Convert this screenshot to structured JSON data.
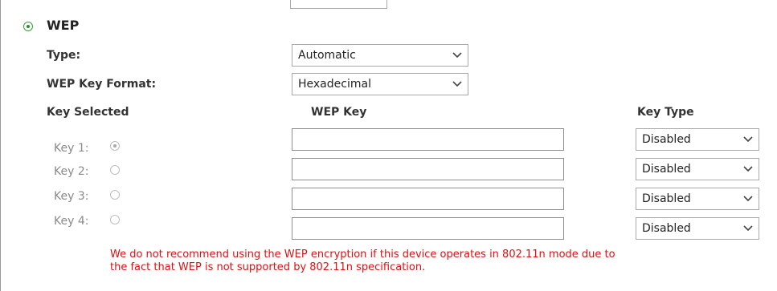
{
  "security_mode": {
    "label": "WEP",
    "selected": true
  },
  "type": {
    "label": "Type:",
    "value": "Automatic"
  },
  "key_format": {
    "label": "WEP Key Format:",
    "value": "Hexadecimal"
  },
  "columns": {
    "key_selected": "Key Selected",
    "wep_key": "WEP Key",
    "key_type": "Key Type"
  },
  "keys": [
    {
      "label": "Key 1:",
      "selected": true,
      "value": "",
      "type": "Disabled"
    },
    {
      "label": "Key 2:",
      "selected": false,
      "value": "",
      "type": "Disabled"
    },
    {
      "label": "Key 3:",
      "selected": false,
      "value": "",
      "type": "Disabled"
    },
    {
      "label": "Key 4:",
      "selected": false,
      "value": "",
      "type": "Disabled"
    }
  ],
  "warning": {
    "line1": "We do not recommend using the WEP encryption if this device operates in 802.11n mode due to",
    "line2": "the fact that WEP is not supported by 802.11n specification."
  },
  "colors": {
    "warning": "#e01010",
    "radio_active": "#2a8f2a"
  },
  "icons": {
    "dropdown": "chevron-down-icon"
  }
}
